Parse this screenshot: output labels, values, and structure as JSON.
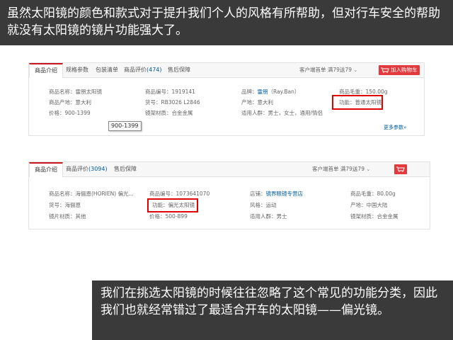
{
  "captions": {
    "top": "虽然太阳镜的颜色和款式对于提升我们个人的风格有所帮助，但对行车安全的帮助就没有太阳镜的镜片功能强大了。",
    "bottom": "我们在挑选太阳镜的时候往往忽略了这个常见的功能分类，因此我们也就经常错过了最适合开车的太阳镜——偏光镜。"
  },
  "listing1": {
    "tabs": [
      "商品介绍",
      "规格参数",
      "包装清单",
      "商品评价",
      "售后保障"
    ],
    "review_count": "(474)",
    "promo_text": "客户端首单 满79送79",
    "cart_button": "加入购物车",
    "cells": {
      "name": "商品名称：雷朋太阳镜",
      "origin": "商品产地：意大利",
      "price": "价格：900-1399",
      "sku": "商品编号：1919141",
      "model": "货号：RB3026 L2846",
      "frame": "镜架材质：合金金属",
      "brand_label": "品牌：",
      "brand_value": "雷朋",
      "brand_suffix": "（Ray.Ban）",
      "place": "产地：意大利",
      "audience": "适用人群：男士，女士，通用/情侣",
      "weight": "商品毛重：150.00g",
      "function": "功能：普通太阳镜"
    },
    "tooltip": "900-1399",
    "more_link": "更多参数»"
  },
  "listing2": {
    "tabs": [
      "商品介绍",
      "商品评价",
      "售后保障"
    ],
    "review_count": "(3094)",
    "promo_text": "客户端首单 满79送79",
    "cells": {
      "name": "商品名称：海俪恩(HORIEN) 偏光...",
      "model": "货号：海俪恩",
      "lens": "镜片材质：其他",
      "sku": "商品编号：1073641070",
      "function": "功能：偏光太阳镜",
      "price": "价格：500-899",
      "shop_label": "店铺：",
      "shop_value": "镜界眼镜专营店",
      "style": "风格：运动",
      "audience": "适用人群：男士",
      "weight": "商品毛重：80.00g",
      "place": "产地：中国大陆",
      "frame": "镜架材质：合金金属"
    }
  },
  "colors": {
    "caption_bg": "#3a3a3a",
    "highlight_red": "#e00000",
    "brand_red": "#e4393c",
    "link_blue": "#005ea7"
  }
}
